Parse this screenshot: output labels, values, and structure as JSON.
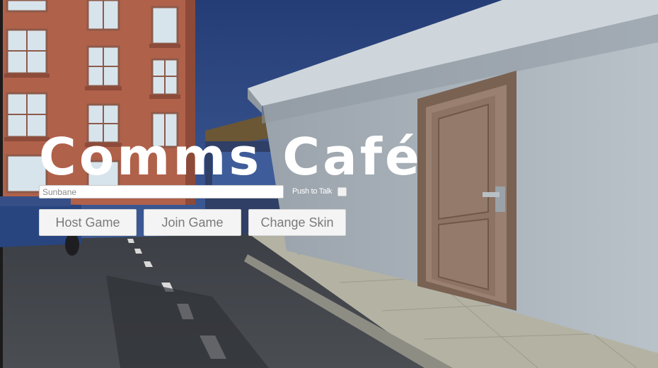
{
  "menu": {
    "title": "Comms Café",
    "name_input_value": "Sunbane",
    "push_to_talk_label": "Push to Talk",
    "push_to_talk_checked": false,
    "buttons": {
      "host": "Host Game",
      "join": "Join Game",
      "skin": "Change Skin"
    }
  },
  "colors": {
    "title": "#ffffff",
    "button_bg": "#f4f4f4",
    "button_text": "#7a7a7a",
    "sky": "#2d4a86",
    "wall": "#a9b4bd",
    "door": "#8f7766"
  }
}
